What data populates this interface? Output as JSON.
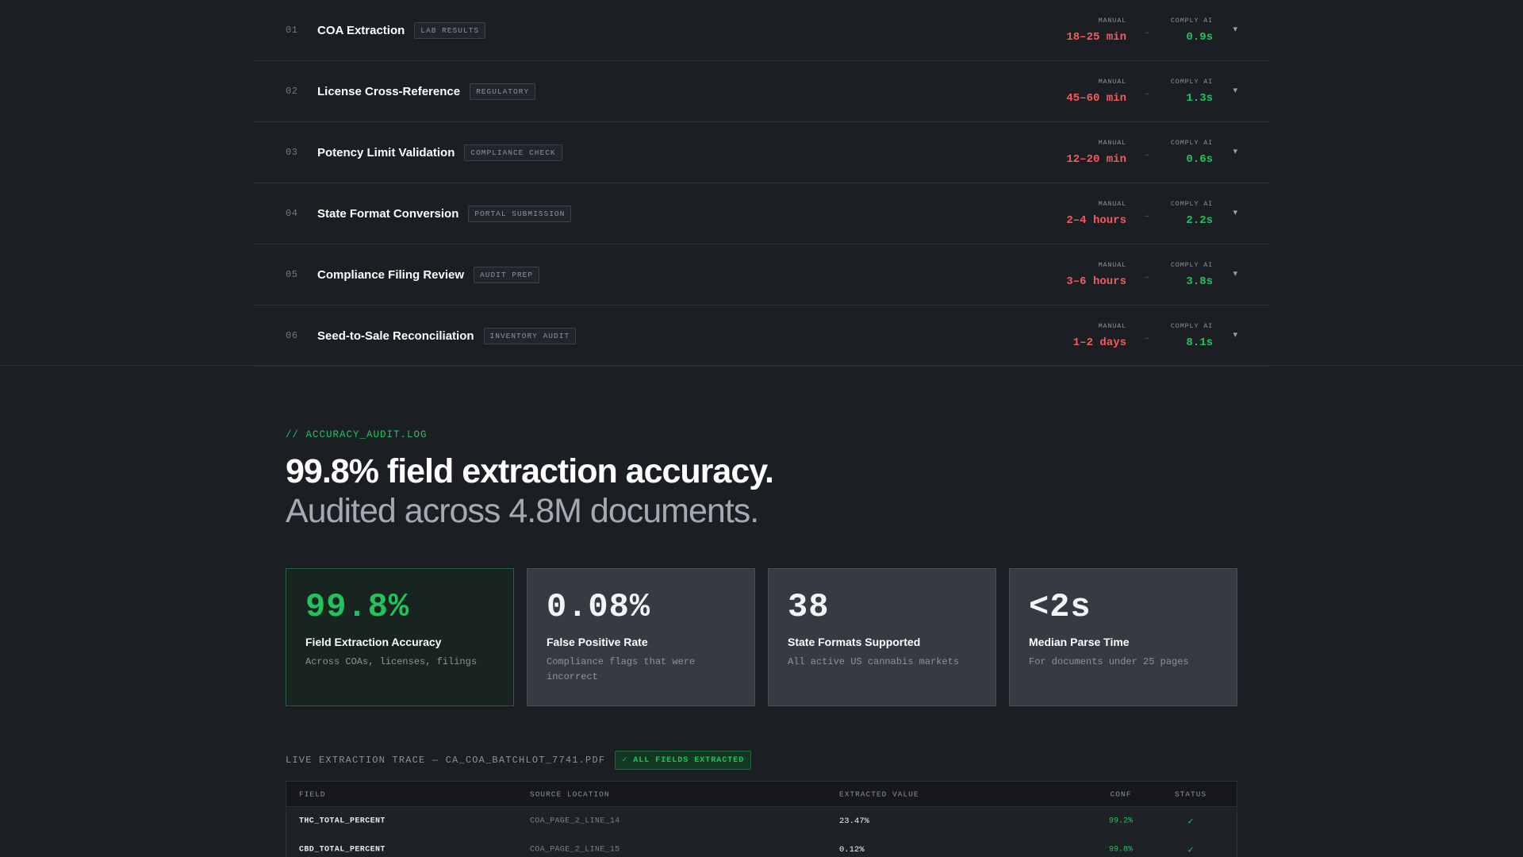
{
  "comparison": {
    "manual_label": "MANUAL",
    "ai_label": "COMPLY AI",
    "arrow": "→",
    "chevron": "▾",
    "rows": [
      {
        "num": "01",
        "name": "COA Extraction",
        "tag": "LAB RESULTS",
        "manual": "18–25 min",
        "ai": "0.9s"
      },
      {
        "num": "02",
        "name": "License Cross-Reference",
        "tag": "REGULATORY",
        "manual": "45–60 min",
        "ai": "1.3s"
      },
      {
        "num": "03",
        "name": "Potency Limit Validation",
        "tag": "COMPLIANCE CHECK",
        "manual": "12–20 min",
        "ai": "0.6s"
      },
      {
        "num": "04",
        "name": "State Format Conversion",
        "tag": "PORTAL SUBMISSION",
        "manual": "2–4 hours",
        "ai": "2.2s"
      },
      {
        "num": "05",
        "name": "Compliance Filing Review",
        "tag": "AUDIT PREP",
        "manual": "3–6 hours",
        "ai": "3.8s"
      },
      {
        "num": "06",
        "name": "Seed-to-Sale Reconciliation",
        "tag": "INVENTORY AUDIT",
        "manual": "1–2 days",
        "ai": "8.1s"
      }
    ]
  },
  "accuracy": {
    "section_tag": "// ACCURACY_AUDIT.LOG",
    "headline": "99.8% field extraction accuracy.",
    "subheadline": "Audited across 4.8M documents.",
    "cards": [
      {
        "value": "99.8%",
        "title": "Field Extraction Accuracy",
        "desc": "Across COAs, licenses, filings"
      },
      {
        "value": "0.08%",
        "title": "False Positive Rate",
        "desc": "Compliance flags that were incorrect"
      },
      {
        "value": "38",
        "title": "State Formats Supported",
        "desc": "All active US cannabis markets"
      },
      {
        "value": "<2s",
        "title": "Median Parse Time",
        "desc": "For documents under 25 pages"
      }
    ]
  },
  "trace": {
    "title": "LIVE EXTRACTION TRACE — CA_COA_BATCHLOT_7741.PDF",
    "badge": "✓ ALL FIELDS EXTRACTED",
    "columns": {
      "field": "FIELD",
      "source": "SOURCE LOCATION",
      "value": "EXTRACTED VALUE",
      "conf": "CONF",
      "status": "STATUS"
    },
    "rows": [
      {
        "field": "THC_TOTAL_PERCENT",
        "source": "COA_PAGE_2_LINE_14",
        "value": "23.47%",
        "conf": "99.2%",
        "status": "✓"
      },
      {
        "field": "CBD_TOTAL_PERCENT",
        "source": "COA_PAGE_2_LINE_15",
        "value": "0.12%",
        "conf": "99.8%",
        "status": "✓"
      }
    ]
  },
  "colors": {
    "background": "#1b1e23",
    "accent_green": "#22c35d",
    "manual_red": "#f25c5c"
  }
}
